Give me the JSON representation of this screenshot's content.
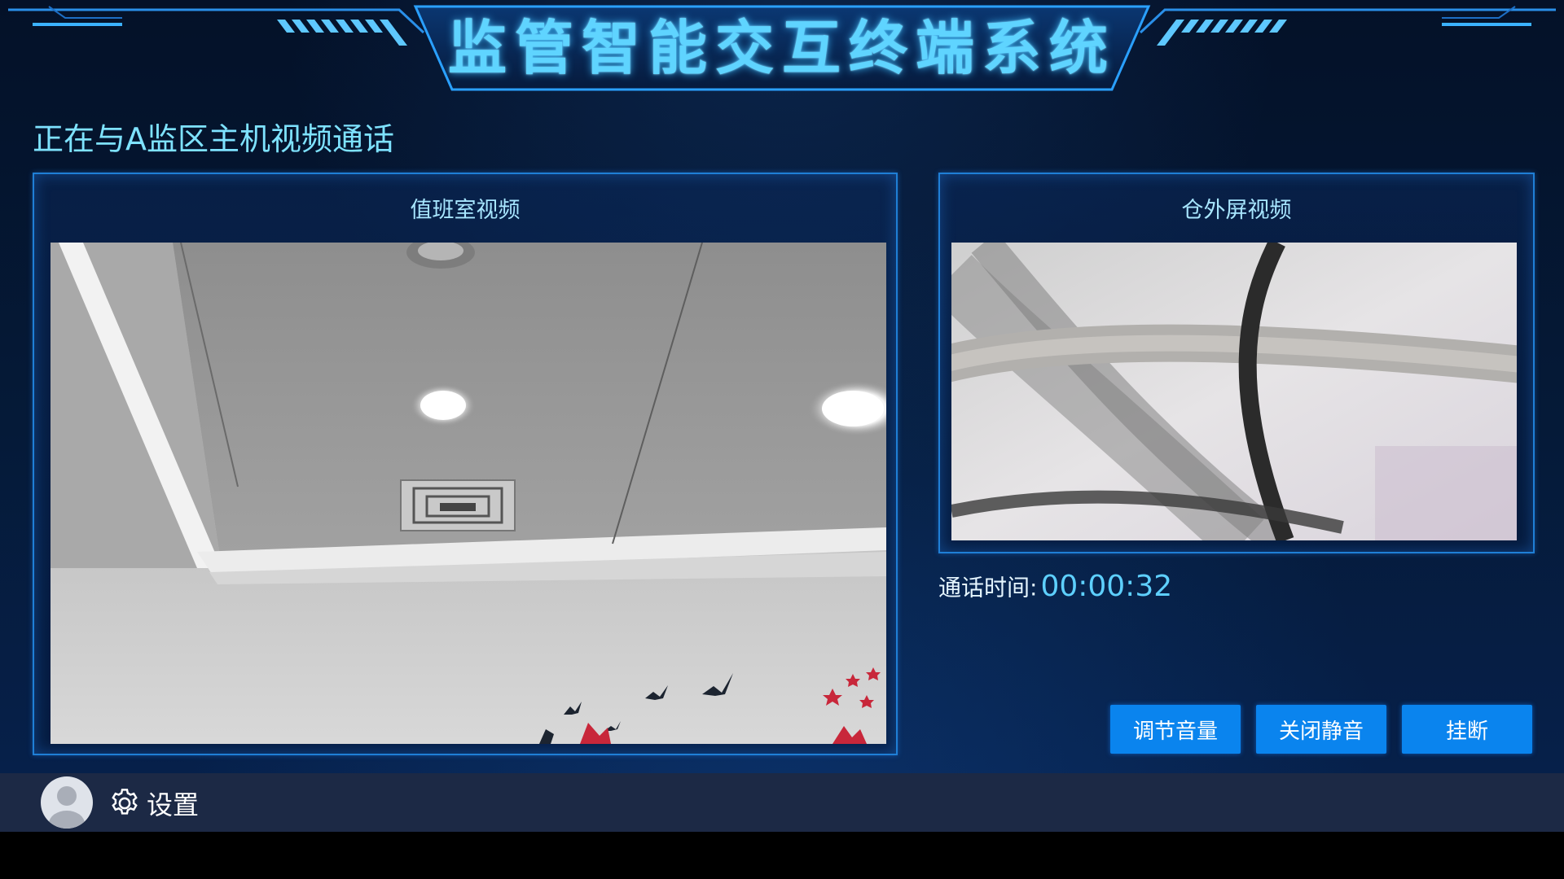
{
  "header": {
    "app_title": "监管智能交互终端系统"
  },
  "call": {
    "status_text": "正在与A监区主机视频通话",
    "duration_label": "通话时间:",
    "duration_value": "00:00:32"
  },
  "panels": {
    "duty_room": {
      "title": "值班室视频"
    },
    "outside_screen": {
      "title": "仓外屏视频"
    }
  },
  "actions": {
    "volume_label": "调节音量",
    "mute_label": "关闭静音",
    "hangup_label": "挂断"
  },
  "bottombar": {
    "settings_label": "设置"
  },
  "colors": {
    "accent": "#5fd4ff",
    "button": "#0a84ee",
    "panel_border": "#1f7fd6",
    "bottombar": "#1c2945"
  },
  "icons": [
    "avatar-icon",
    "gear-icon"
  ]
}
